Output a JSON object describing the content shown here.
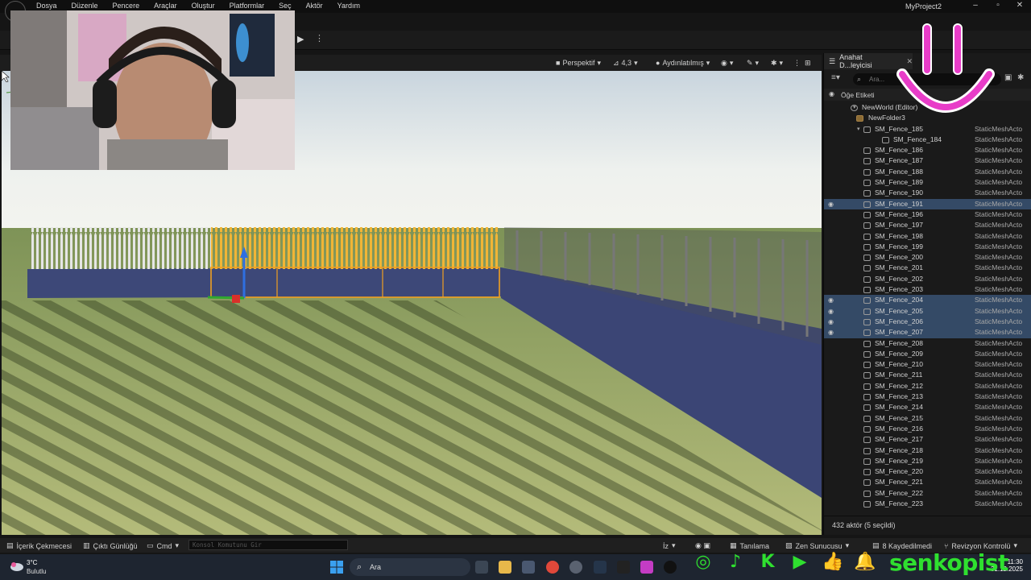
{
  "menubar": {
    "items": [
      "Dosya",
      "Düzenle",
      "Pencere",
      "Araçlar",
      "Oluştur",
      "Platformlar",
      "Seç",
      "Aktör",
      "Yardım"
    ],
    "project_name": "MyProject2"
  },
  "viewport": {
    "view_mode": "Perspektif",
    "fov": "4,3",
    "lighting": "Aydınlatılmış"
  },
  "outliner": {
    "tab_title": "Anahat D...leyicisi",
    "search_placeholder": "Ara...",
    "column_label": "Öğe Etiketi",
    "world": "NewWorld (Editor)",
    "folder": "NewFolder3",
    "type_label": "StaticMeshActo",
    "rows": [
      {
        "name": "SM_Fence_185",
        "selected": false,
        "indent": 1,
        "expanded": true
      },
      {
        "name": "SM_Fence_184",
        "selected": false,
        "indent": 2
      },
      {
        "name": "SM_Fence_186",
        "selected": false,
        "indent": 1
      },
      {
        "name": "SM_Fence_187",
        "selected": false,
        "indent": 1
      },
      {
        "name": "SM_Fence_188",
        "selected": false,
        "indent": 1
      },
      {
        "name": "SM_Fence_189",
        "selected": false,
        "indent": 1
      },
      {
        "name": "SM_Fence_190",
        "selected": false,
        "indent": 1
      },
      {
        "name": "SM_Fence_191",
        "selected": true,
        "indent": 1
      },
      {
        "name": "SM_Fence_196",
        "selected": false,
        "indent": 1
      },
      {
        "name": "SM_Fence_197",
        "selected": false,
        "indent": 1
      },
      {
        "name": "SM_Fence_198",
        "selected": false,
        "indent": 1
      },
      {
        "name": "SM_Fence_199",
        "selected": false,
        "indent": 1
      },
      {
        "name": "SM_Fence_200",
        "selected": false,
        "indent": 1
      },
      {
        "name": "SM_Fence_201",
        "selected": false,
        "indent": 1
      },
      {
        "name": "SM_Fence_202",
        "selected": false,
        "indent": 1
      },
      {
        "name": "SM_Fence_203",
        "selected": false,
        "indent": 1
      },
      {
        "name": "SM_Fence_204",
        "selected": true,
        "indent": 1
      },
      {
        "name": "SM_Fence_205",
        "selected": true,
        "indent": 1
      },
      {
        "name": "SM_Fence_206",
        "selected": true,
        "indent": 1
      },
      {
        "name": "SM_Fence_207",
        "selected": true,
        "indent": 1
      },
      {
        "name": "SM_Fence_208",
        "selected": false,
        "indent": 1
      },
      {
        "name": "SM_Fence_209",
        "selected": false,
        "indent": 1
      },
      {
        "name": "SM_Fence_210",
        "selected": false,
        "indent": 1
      },
      {
        "name": "SM_Fence_211",
        "selected": false,
        "indent": 1
      },
      {
        "name": "SM_Fence_212",
        "selected": false,
        "indent": 1
      },
      {
        "name": "SM_Fence_213",
        "selected": false,
        "indent": 1
      },
      {
        "name": "SM_Fence_214",
        "selected": false,
        "indent": 1
      },
      {
        "name": "SM_Fence_215",
        "selected": false,
        "indent": 1
      },
      {
        "name": "SM_Fence_216",
        "selected": false,
        "indent": 1
      },
      {
        "name": "SM_Fence_217",
        "selected": false,
        "indent": 1
      },
      {
        "name": "SM_Fence_218",
        "selected": false,
        "indent": 1
      },
      {
        "name": "SM_Fence_219",
        "selected": false,
        "indent": 1
      },
      {
        "name": "SM_Fence_220",
        "selected": false,
        "indent": 1
      },
      {
        "name": "SM_Fence_221",
        "selected": false,
        "indent": 1
      },
      {
        "name": "SM_Fence_222",
        "selected": false,
        "indent": 1
      },
      {
        "name": "SM_Fence_223",
        "selected": false,
        "indent": 1
      }
    ],
    "footer": "432 aktör (5 seçildi)"
  },
  "statusbar": {
    "content_drawer": "İçerik Çekmecesi",
    "output_log": "Çıktı Günlüğü",
    "cmd": "Cmd",
    "console_placeholder": "Konsol Komutunu Gir",
    "trace": "İz",
    "derived_data": "Tanılama",
    "zen_server": "Zen Sunucusu",
    "unsaved": "8 Kaydedilmedi",
    "revision_control": "Revizyon Kontrolü"
  },
  "taskbar": {
    "temperature": "3°C",
    "condition": "Bulutlu",
    "search_label": "Ara",
    "time": "11:30",
    "date": "31.12.2025"
  },
  "overlay": {
    "streamer_name": "senkopist"
  },
  "colors": {
    "selection": "#344a66",
    "accent_green": "#2fe02f",
    "smiley": "#e83cc8",
    "wall_blue": "#3d4878",
    "grass": "#8fa16a",
    "selected_outline": "#f0a020"
  }
}
